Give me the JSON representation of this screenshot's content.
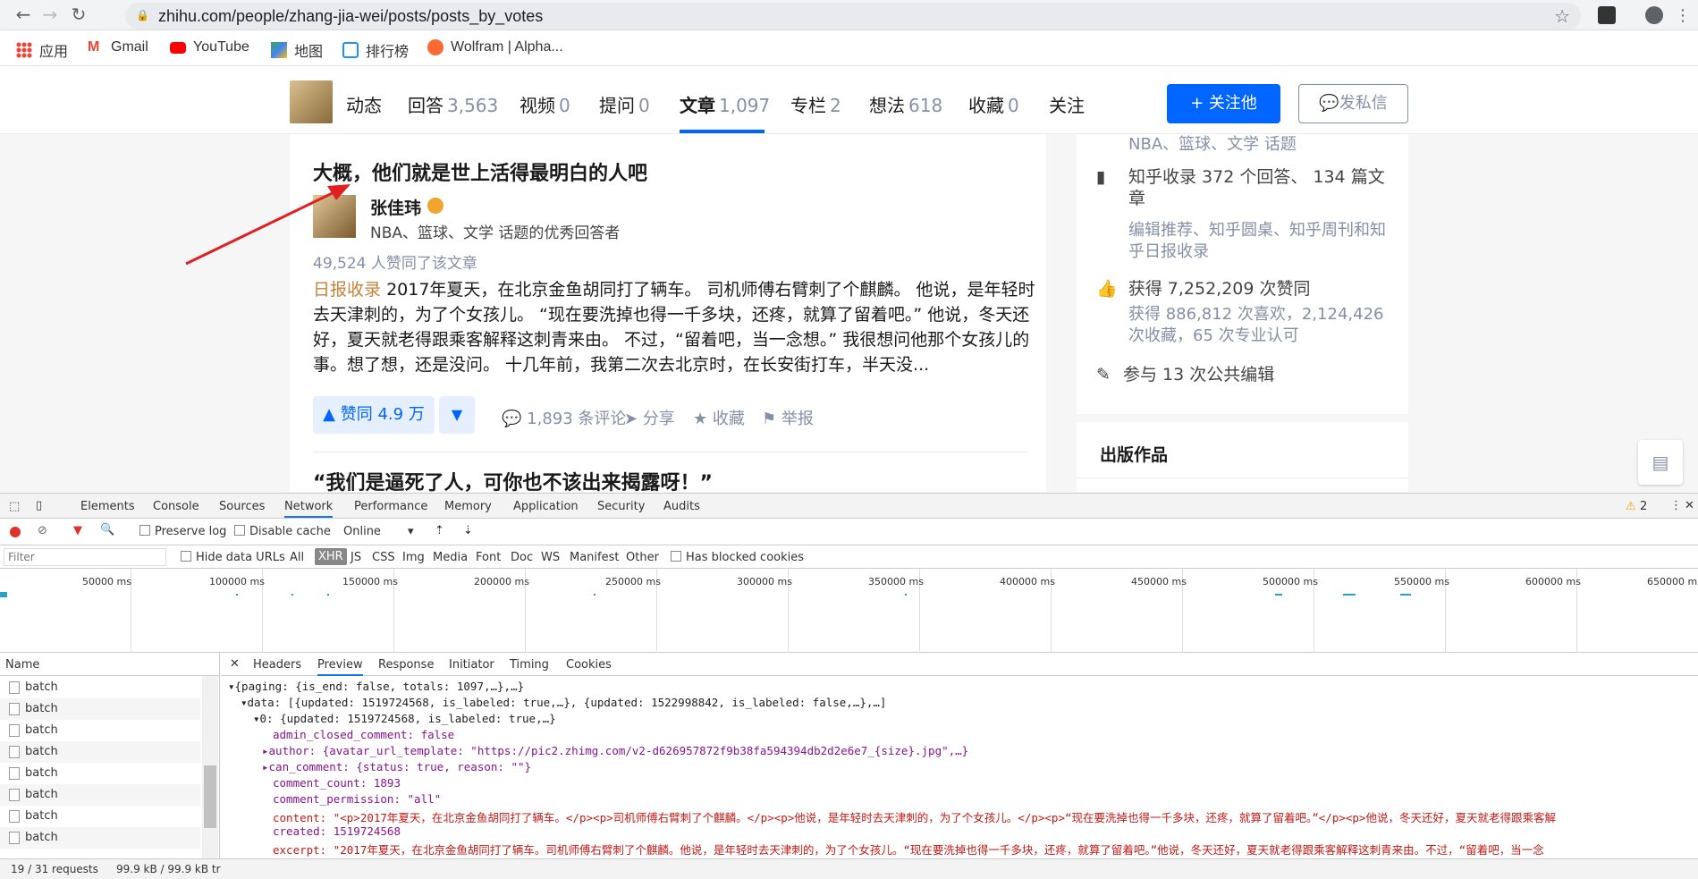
{
  "browser": {
    "url": "zhihu.com/people/zhang-jia-wei/posts/posts_by_votes",
    "bookmarks": [
      "应用",
      "Gmail",
      "YouTube",
      "地图",
      "排行榜",
      "Wolfram | Alpha..."
    ]
  },
  "profile_nav": {
    "tabs": [
      {
        "label": "动态",
        "count": ""
      },
      {
        "label": "回答",
        "count": "3,563"
      },
      {
        "label": "视频",
        "count": "0"
      },
      {
        "label": "提问",
        "count": "0"
      },
      {
        "label": "文章",
        "count": "1,097"
      },
      {
        "label": "专栏",
        "count": "2"
      },
      {
        "label": "想法",
        "count": "618"
      },
      {
        "label": "收藏",
        "count": "0"
      },
      {
        "label": "关注",
        "count": ""
      }
    ],
    "follow_button": "关注他",
    "message_button": "发私信"
  },
  "article": {
    "title": "大概，他们就是世上活得最明白的人吧",
    "author_name": "张佳玮",
    "author_desc": "NBA、篮球、文学 话题的优秀回答者",
    "votes_text": "49,524 人赞同了该文章",
    "tag": "日报收录",
    "excerpt": "2017年夏天，在北京金鱼胡同打了辆车。 司机师傅右臂刺了个麒麟。 他说，是年轻时去天津刺的，为了个女孩儿。 “现在要洗掉也得一千多块，还疼，就算了留着吧。” 他说，冬天还好，夏天就老得跟乘客解释这刺青来由。 不过，“留着吧，当一念想。” 我很想问他那个女孩儿的事。想了想，还是没问。 十几年前，我第二次去北京时，在长安街打车，半天没...",
    "vote_btn": "赞同 4.9 万",
    "comments": "1,893 条评论",
    "share": "分享",
    "collect": "收藏",
    "report": "举报",
    "next_title": "“我们是逼死了人，可你也不该出来揭露呀！”"
  },
  "sidebar": {
    "topics": "NBA、篮球、文学 话题",
    "collected": "知乎收录 372 个回答、 134 篇文章",
    "collected_sub": "编辑推荐、知乎圆桌、知乎周刊和知乎日报收录",
    "likes": "获得 7,252,209 次赞同",
    "likes_sub": "获得 886,812 次喜欢，2,124,426 次收藏，65 次专业认可",
    "edits": "参与 13 次公共编辑",
    "published": "出版作品"
  },
  "devtools": {
    "tabs": [
      "Elements",
      "Console",
      "Sources",
      "Network",
      "Performance",
      "Memory",
      "Application",
      "Security",
      "Audits"
    ],
    "warnings": "2",
    "preserve_log": "Preserve log",
    "disable_cache": "Disable cache",
    "throttle": "Online",
    "filter_placeholder": "Filter",
    "hide_data_urls": "Hide data URLs",
    "types": [
      "All",
      "XHR",
      "JS",
      "CSS",
      "Img",
      "Media",
      "Font",
      "Doc",
      "WS",
      "Manifest",
      "Other"
    ],
    "blocked": "Has blocked cookies",
    "timeline_labels": [
      "50000 ms",
      "100000 ms",
      "150000 ms",
      "200000 ms",
      "250000 ms",
      "300000 ms",
      "350000 ms",
      "400000 ms",
      "450000 ms",
      "500000 ms",
      "550000 ms",
      "600000 ms",
      "650000 m"
    ],
    "name_header": "Name",
    "requests": [
      "batch",
      "batch",
      "batch",
      "batch",
      "batch",
      "batch",
      "batch",
      "batch"
    ],
    "detail_tabs": [
      "Headers",
      "Preview",
      "Response",
      "Initiator",
      "Timing",
      "Cookies"
    ],
    "preview_lines": [
      "▾{paging: {is_end: false, totals: 1097,…},…}",
      "▾data: [{updated: 1519724568, is_labeled: true,…}, {updated: 1522998842, is_labeled: false,…},…]",
      "▾0: {updated: 1519724568, is_labeled: true,…}",
      "admin_closed_comment: false",
      "▸author: {avatar_url_template: \"https://pic2.zhimg.com/v2-d626957872f9b38fa594394db2d2e6e7_{size}.jpg\",…}",
      "▸can_comment: {status: true, reason: \"\"}",
      "comment_count: 1893",
      "comment_permission: \"all\"",
      "content: \"<p>2017年夏天，在北京金鱼胡同打了辆车。</p><p>司机师傅右臂刺了个麒麟。</p><p>他说，是年轻时去天津刺的，为了个女孩儿。</p><p>“现在要洗掉也得一千多块，还疼，就算了留着吧。”</p><p>他说，冬天还好，夏天就老得跟乘客解",
      "created: 1519724568",
      "excerpt: \"2017年夏天，在北京金鱼胡同打了辆车。司机师傅右臂刺了个麒麟。他说，是年轻时去天津刺的，为了个女孩儿。“现在要洗掉也得一千多块，还疼，就算了留着吧。”他说，冬天还好，夏天就老得跟乘客解释这刺青来由。不过，“留着吧，当一念"
    ],
    "status_requests": "19 / 31 requests",
    "status_size": "99.9 kB / 99.9 kB tr"
  }
}
